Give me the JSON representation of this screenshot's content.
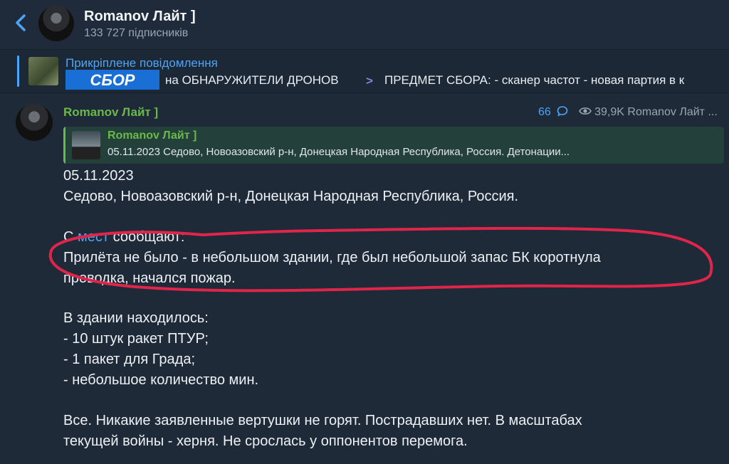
{
  "header": {
    "channel_name": "Romanov Лайт ]",
    "subscribers": "133 727 підписників"
  },
  "pinned": {
    "title": "Прикріплене повідомлення",
    "banner_text": "СБОР",
    "text": "на ОБНАРУЖИТЕЛИ ДРОНОВ",
    "text2": "ПРЕДМЕТ СБОРА:  - сканер частот - новая партия в к"
  },
  "message": {
    "author": "Romanov Лайт ]",
    "comments": "66",
    "views": "39,9K Romanov Лайт ...",
    "forward": {
      "author": "Romanov Лайт ]",
      "text": "05.11.2023 Седово, Новоазовский р-н, Донецкая Народная Республика, Россия.  Детонации..."
    },
    "lines": [
      "05.11.2023",
      "Седово, Новоазовский р-н, Донецкая Народная Республика, Россия.",
      "Прилёта не было - в небольшом здании, где был небольшой запас БК коротнула",
      "проводка, начался пожар.",
      "В здании находилось:",
      "- 10 штук ракет ПТУР;",
      "- 1 пакет для Града;",
      "- небольшое количество мин.",
      "Все. Никакие заявленные вертушки не горят. Пострадавших нет. В масштабах",
      "текущей войны - херня. Не срослась у оппонентов перемога."
    ],
    "line_c_prefix": "С ",
    "line_c_link": "мест",
    "line_c_suffix": " сообщают:"
  },
  "colors": {
    "background": "#1e2a38",
    "accent_blue": "#4ea4f6",
    "author_green": "#6ab94a",
    "annotation_red": "#e0244a"
  }
}
